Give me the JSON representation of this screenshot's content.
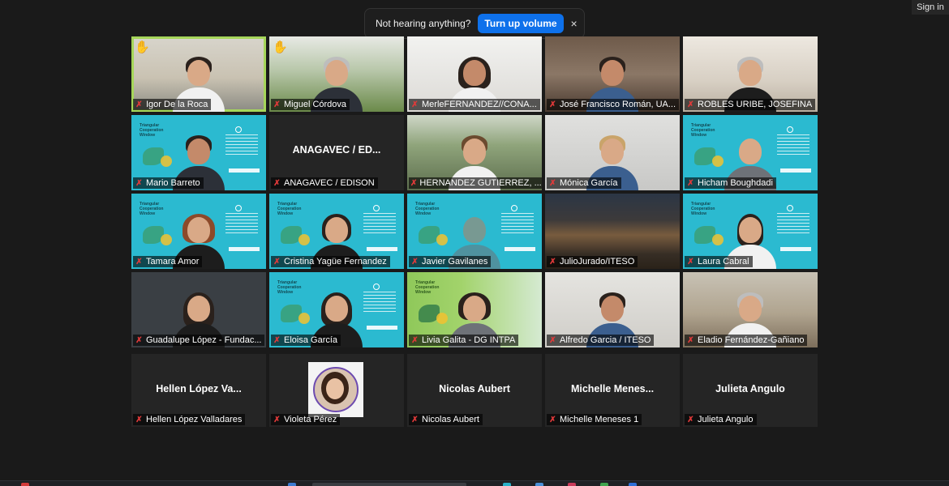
{
  "top": {
    "signin_label": "Sign in",
    "toast_message": "Not hearing anything?",
    "toast_button": "Turn up volume",
    "toast_close": "×"
  },
  "icons": {
    "mic_muted": "mic-off-icon",
    "hand": "raised-hand-icon",
    "close": "close-icon"
  },
  "colors": {
    "accent_blue": "#0e71eb",
    "active_speaker": "#a6d65a",
    "muted_red": "#e23a3a",
    "hand_yellow": "#f7c21b",
    "background": "#1a1a1a"
  },
  "participants": [
    {
      "name": "Igor De la Roca",
      "hand_raised": true,
      "active": true
    },
    {
      "name": "Miguel Córdova",
      "hand_raised": true
    },
    {
      "name": "MerleFERNANDEZ//CONA..."
    },
    {
      "name": "José Francisco Román, UA..."
    },
    {
      "name": "ROBLES URIBE, JOSEFINA"
    },
    {
      "name": "Mario Barreto"
    },
    {
      "name": "ANAGAVEC / EDISON",
      "display_name": "ANAGAVEC / ED..."
    },
    {
      "name": "HERNANDEZ GUTIERREZ, ..."
    },
    {
      "name": "Mónica García"
    },
    {
      "name": "Hicham Boughdadi"
    },
    {
      "name": "Tamara Amor"
    },
    {
      "name": "Cristina Yagüe Fernandez"
    },
    {
      "name": "Javier Gavilanes"
    },
    {
      "name": "JulioJurado/ITESO"
    },
    {
      "name": "Laura Cabral"
    },
    {
      "name": "Guadalupe López - Fundac..."
    },
    {
      "name": "Eloisa García"
    },
    {
      "name": "Livia Galita - DG INTPA"
    },
    {
      "name": "Alfredo Garcia / ITESO"
    },
    {
      "name": "Eladio Fernández-Gañiano"
    },
    {
      "name": "Hellen López Valladares",
      "display_name": "Hellen  López  Va..."
    },
    {
      "name": "Violeta Pérez"
    },
    {
      "name": "Nicolas Aubert",
      "display_name": "Nicolas Aubert"
    },
    {
      "name": "Michelle  Meneses 1",
      "display_name": "Michelle  Menes..."
    },
    {
      "name": "Julieta Angulo",
      "display_name": "Julieta Angulo"
    }
  ]
}
